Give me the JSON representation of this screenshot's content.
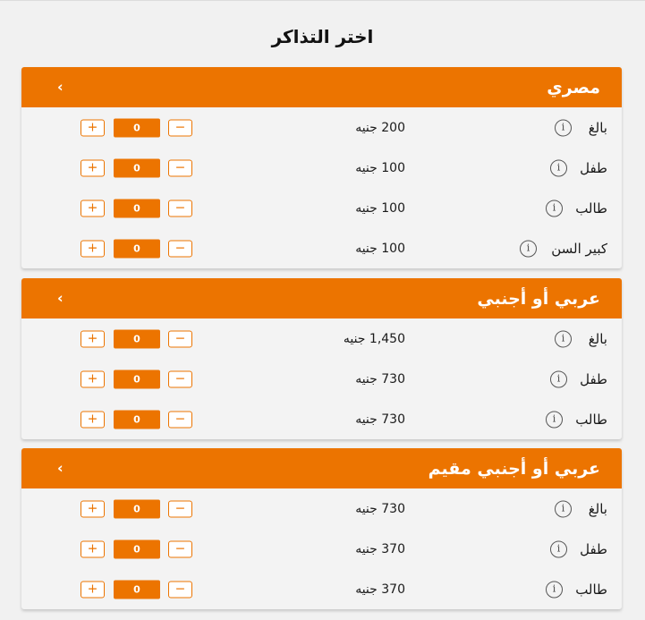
{
  "page_title": "اختر التذاكر",
  "colors": {
    "accent": "#ec7400",
    "background": "#f1f1f1",
    "panel": "#f3f3f3"
  },
  "icons": {
    "info": "info-icon",
    "collapse": "chevron-left-icon",
    "plus": "plus-icon",
    "minus": "minus-icon"
  },
  "controls": {
    "plus": "+",
    "minus": "−",
    "chevron": "‹",
    "info": "i"
  },
  "sections": [
    {
      "title": "مصري",
      "rows": [
        {
          "type": "بالغ",
          "price": "200 جنيه",
          "qty": "0"
        },
        {
          "type": "طفل",
          "price": "100 جنيه",
          "qty": "0"
        },
        {
          "type": "طالب",
          "price": "100 جنيه",
          "qty": "0"
        },
        {
          "type": "كبير السن",
          "price": "100 جنيه",
          "qty": "0"
        }
      ]
    },
    {
      "title": "عربي أو أجنبي",
      "rows": [
        {
          "type": "بالغ",
          "price": "1,450 جنيه",
          "qty": "0"
        },
        {
          "type": "طفل",
          "price": "730 جنيه",
          "qty": "0"
        },
        {
          "type": "طالب",
          "price": "730 جنيه",
          "qty": "0"
        }
      ]
    },
    {
      "title": "عربي أو أجنبي مقيم",
      "rows": [
        {
          "type": "بالغ",
          "price": "730 جنيه",
          "qty": "0"
        },
        {
          "type": "طفل",
          "price": "370 جنيه",
          "qty": "0"
        },
        {
          "type": "طالب",
          "price": "370 جنيه",
          "qty": "0"
        }
      ]
    }
  ]
}
